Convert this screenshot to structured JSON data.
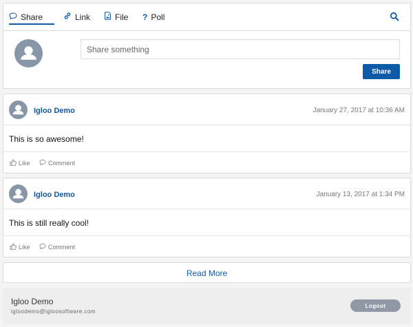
{
  "composer": {
    "tabs": [
      {
        "label": "Share",
        "icon": "comment-icon"
      },
      {
        "label": "Link",
        "icon": "link-icon"
      },
      {
        "label": "File",
        "icon": "file-image-icon"
      },
      {
        "label": "Poll",
        "icon": "question-icon"
      }
    ],
    "active_tab": "Share",
    "search_icon": "search-icon",
    "input_placeholder": "Share something",
    "share_label": "Share"
  },
  "posts": [
    {
      "author": "Igloo Demo",
      "date": "January 27, 2017 at 10:36 AM",
      "text": "This is so awesome!",
      "like_label": "Like",
      "comment_label": "Comment"
    },
    {
      "author": "Igloo Demo",
      "date": "January 13, 2017 at 1:34 PM",
      "text": "This is still really cool!",
      "like_label": "Like",
      "comment_label": "Comment"
    }
  ],
  "read_more_label": "Read More",
  "footer": {
    "name": "Igloo Demo",
    "email": "igloodemo@igloosoftware.com",
    "logout_label": "Logout"
  },
  "colors": {
    "accent": "#0f5aa6",
    "avatar": "#8797a8",
    "logout": "#8f99a6"
  }
}
